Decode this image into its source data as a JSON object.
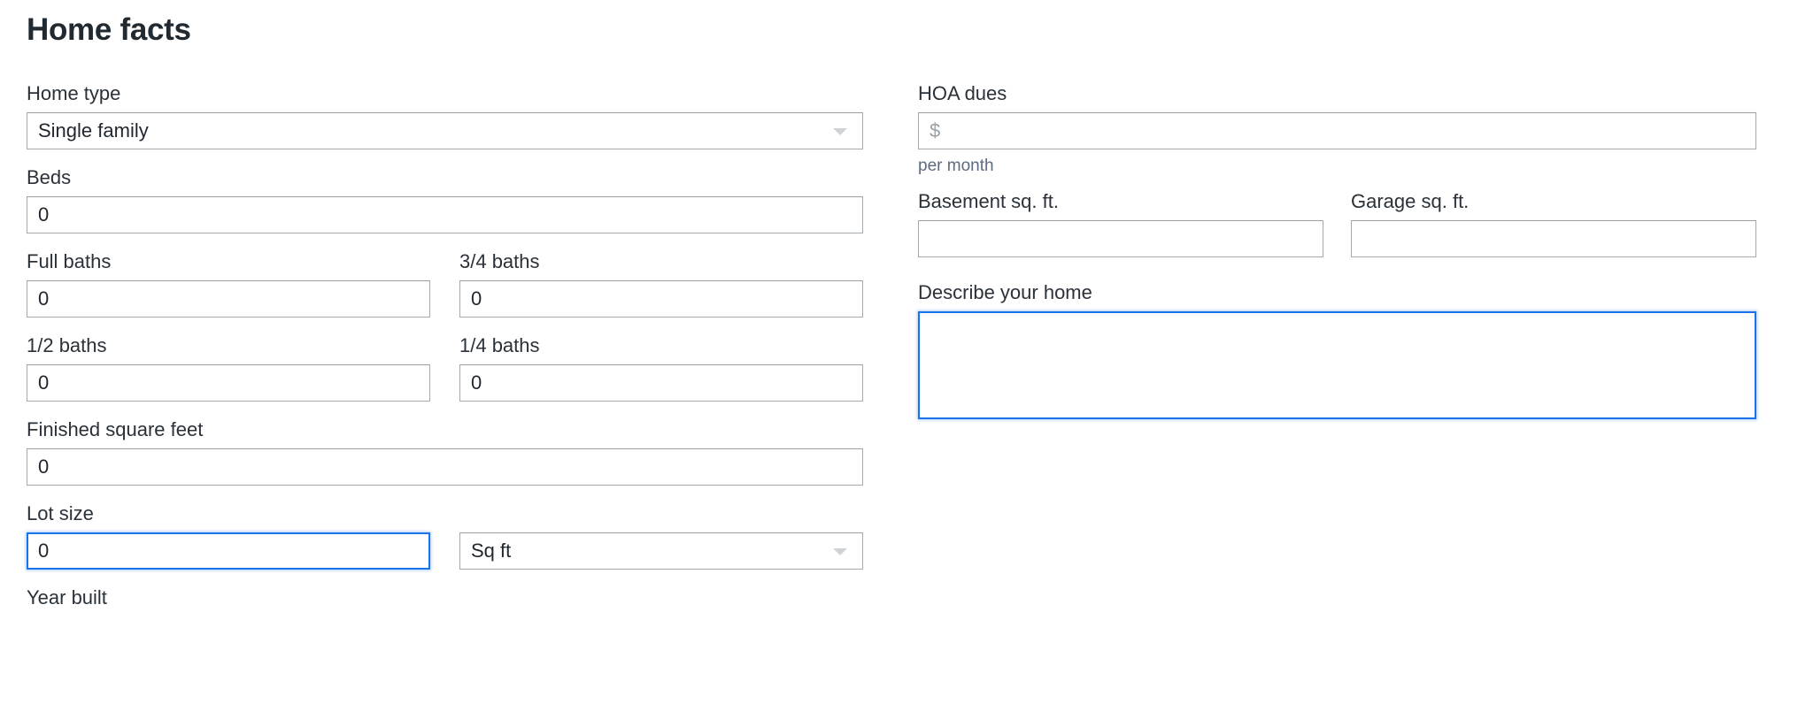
{
  "header": {
    "title": "Home facts"
  },
  "colors": {
    "accent": "#1a73e8",
    "border": "#a5aaae",
    "text": "#2a3139",
    "title": "#222a31",
    "helper": "#5d6b7e",
    "placeholder": "#9aa0a6",
    "caret": "#cfd3d6"
  },
  "icons": {
    "caret": "chevron-down-icon"
  },
  "left_column": {
    "home_type": {
      "label": "Home type",
      "value": "Single family",
      "options": [
        "Single family"
      ]
    },
    "beds": {
      "label": "Beds",
      "value": "0"
    },
    "full_baths": {
      "label": "Full baths",
      "value": "0"
    },
    "three_quarter_baths": {
      "label": "3/4 baths",
      "value": "0"
    },
    "half_baths": {
      "label": "1/2 baths",
      "value": "0"
    },
    "quarter_baths": {
      "label": "1/4 baths",
      "value": "0"
    },
    "finished_square_feet": {
      "label": "Finished square feet",
      "value": "0"
    },
    "lot_size": {
      "label": "Lot size",
      "value": "0",
      "unit_value": "Sq ft",
      "unit_options": [
        "Sq ft"
      ]
    },
    "year_built": {
      "label": "Year built"
    }
  },
  "right_column": {
    "hoa_dues": {
      "label": "HOA dues",
      "value": "",
      "placeholder": "$",
      "helper": "per month"
    },
    "basement_sqft": {
      "label": "Basement sq. ft.",
      "value": ""
    },
    "garage_sqft": {
      "label": "Garage sq. ft.",
      "value": ""
    },
    "describe_home": {
      "label": "Describe your home",
      "value": ""
    }
  }
}
